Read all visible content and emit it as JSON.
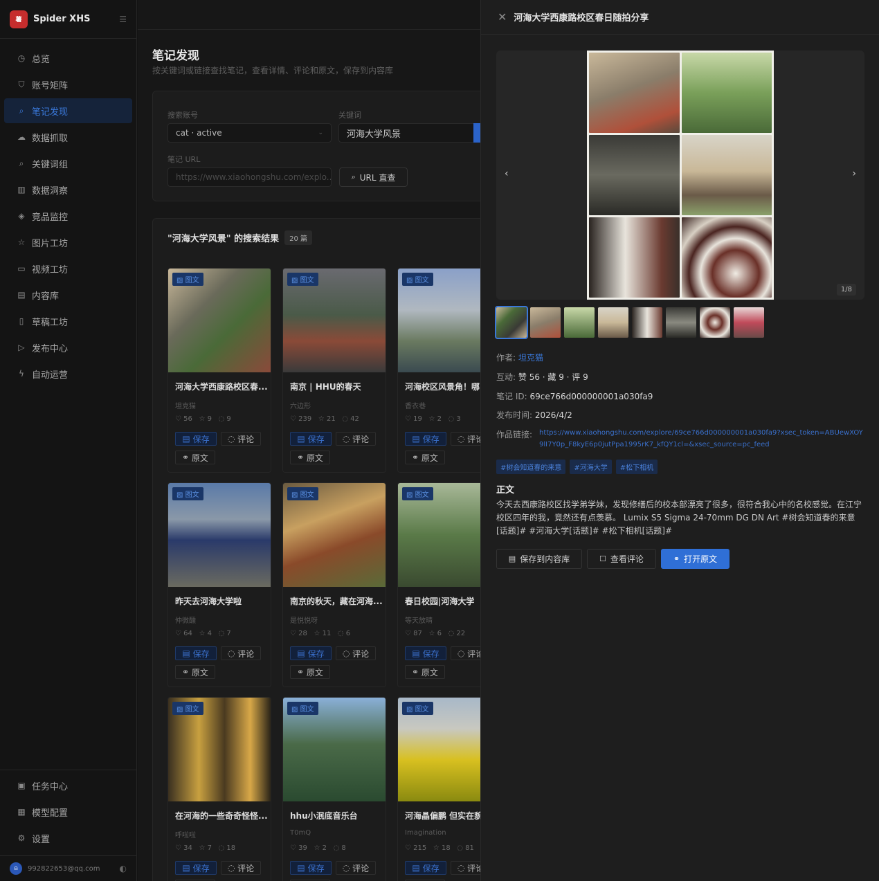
{
  "app": {
    "name": "Spider XHS",
    "logo_text": "薯"
  },
  "sidebar": {
    "items": [
      {
        "label": "总览",
        "icon": "◷"
      },
      {
        "label": "账号矩阵",
        "icon": "⛉"
      },
      {
        "label": "笔记发现",
        "icon": "⌕",
        "active": true
      },
      {
        "label": "数据抓取",
        "icon": "☁"
      },
      {
        "label": "关键词组",
        "icon": "⌕"
      },
      {
        "label": "数据洞察",
        "icon": "▥"
      },
      {
        "label": "竞品监控",
        "icon": "◈"
      },
      {
        "label": "图片工坊",
        "icon": "☆"
      },
      {
        "label": "视频工坊",
        "icon": "▭"
      },
      {
        "label": "内容库",
        "icon": "▤"
      },
      {
        "label": "草稿工坊",
        "icon": "▯"
      },
      {
        "label": "发布中心",
        "icon": "▷"
      },
      {
        "label": "自动运营",
        "icon": "ϟ"
      }
    ],
    "bottom_items": [
      {
        "label": "任务中心",
        "icon": "▣"
      },
      {
        "label": "模型配置",
        "icon": "▦"
      },
      {
        "label": "设置",
        "icon": "⚙"
      }
    ],
    "user_email": "992822653@qq.com"
  },
  "page": {
    "title": "笔记发现",
    "subtitle": "按关键词或链接查找笔记，查看详情、评论和原文，保存到内容库"
  },
  "search": {
    "account_label": "搜索账号",
    "account_value": "cat · active",
    "keyword_label": "关键词",
    "keyword_value": "河海大学风景",
    "url_label": "笔记 URL",
    "url_placeholder": "https://www.xiaohongshu.com/explo...",
    "url_button": "URL 直查"
  },
  "results": {
    "title": "\"河海大学风景\" 的搜索结果",
    "count": "20 篇",
    "type_tag": "图文",
    "save_label": "保存",
    "comment_label": "评论",
    "origin_label": "原文",
    "cards": [
      {
        "title": "河海大学西康路校区春...",
        "author": "坦克猫",
        "likes": "56",
        "stars": "9",
        "comments": "9"
      },
      {
        "title": "南京 | HHU的春天",
        "author": "六边形",
        "likes": "239",
        "stars": "21",
        "comments": "42"
      },
      {
        "title": "河海校区风景角！哪",
        "author": "香衣巷",
        "likes": "19",
        "stars": "2",
        "comments": "3"
      },
      {
        "title": "昨天去河海大学啦",
        "author": "仲微醺",
        "likes": "64",
        "stars": "4",
        "comments": "7"
      },
      {
        "title": "南京的秋天，藏在河海...",
        "author": "是悦悦呀",
        "likes": "28",
        "stars": "11",
        "comments": "6"
      },
      {
        "title": "春日校园|河海大学",
        "author": "等天放晴",
        "likes": "87",
        "stars": "6",
        "comments": "22"
      },
      {
        "title": "在河海的一些奇奇怪怪...",
        "author": "呼啦啦",
        "likes": "34",
        "stars": "7",
        "comments": "18"
      },
      {
        "title": "hhu小泯底音乐台",
        "author": "T0mQ",
        "likes": "39",
        "stars": "2",
        "comments": "8"
      },
      {
        "title": "河海晶偏鹏 但实在貌",
        "author": "Imagination",
        "likes": "215",
        "stars": "18",
        "comments": "81"
      }
    ]
  },
  "drawer": {
    "title": "河海大学西康路校区春日随拍分享",
    "pager": "1/8",
    "author_label": "作者:",
    "author": "坦克猫",
    "interact_label": "互动:",
    "interact": "赞 56 · 藏 9 · 评 9",
    "id_label": "笔记 ID:",
    "id": "69ce766d000000001a030fa9",
    "time_label": "发布时间:",
    "time": "2026/4/2",
    "url_label": "作品链接:",
    "url": "https://www.xiaohongshu.com/explore/69ce766d000000001a030fa9?xsec_token=ABUewXOY9lI7Y0p_F8kyE6p0jutPpa1995rK7_kfQY1cl=&xsec_source=pc_feed",
    "tags": [
      "#树会知道春的来意",
      "#河海大学",
      "#松下相机"
    ],
    "body_heading": "正文",
    "body": "今天去西康路校区找学弟学妹，发现修缮后的校本部漂亮了很多，很符合我心中的名校感觉。在江宁校区四年的我，竟然还有点羡慕。 Lumix S5 Sigma 24-70mm DG DN Art #树会知道春的来意[话题]# #河海大学[话题]# #松下相机[话题]#",
    "save_btn": "保存到内容库",
    "comments_btn": "查看评论",
    "open_btn": "打开原文"
  }
}
